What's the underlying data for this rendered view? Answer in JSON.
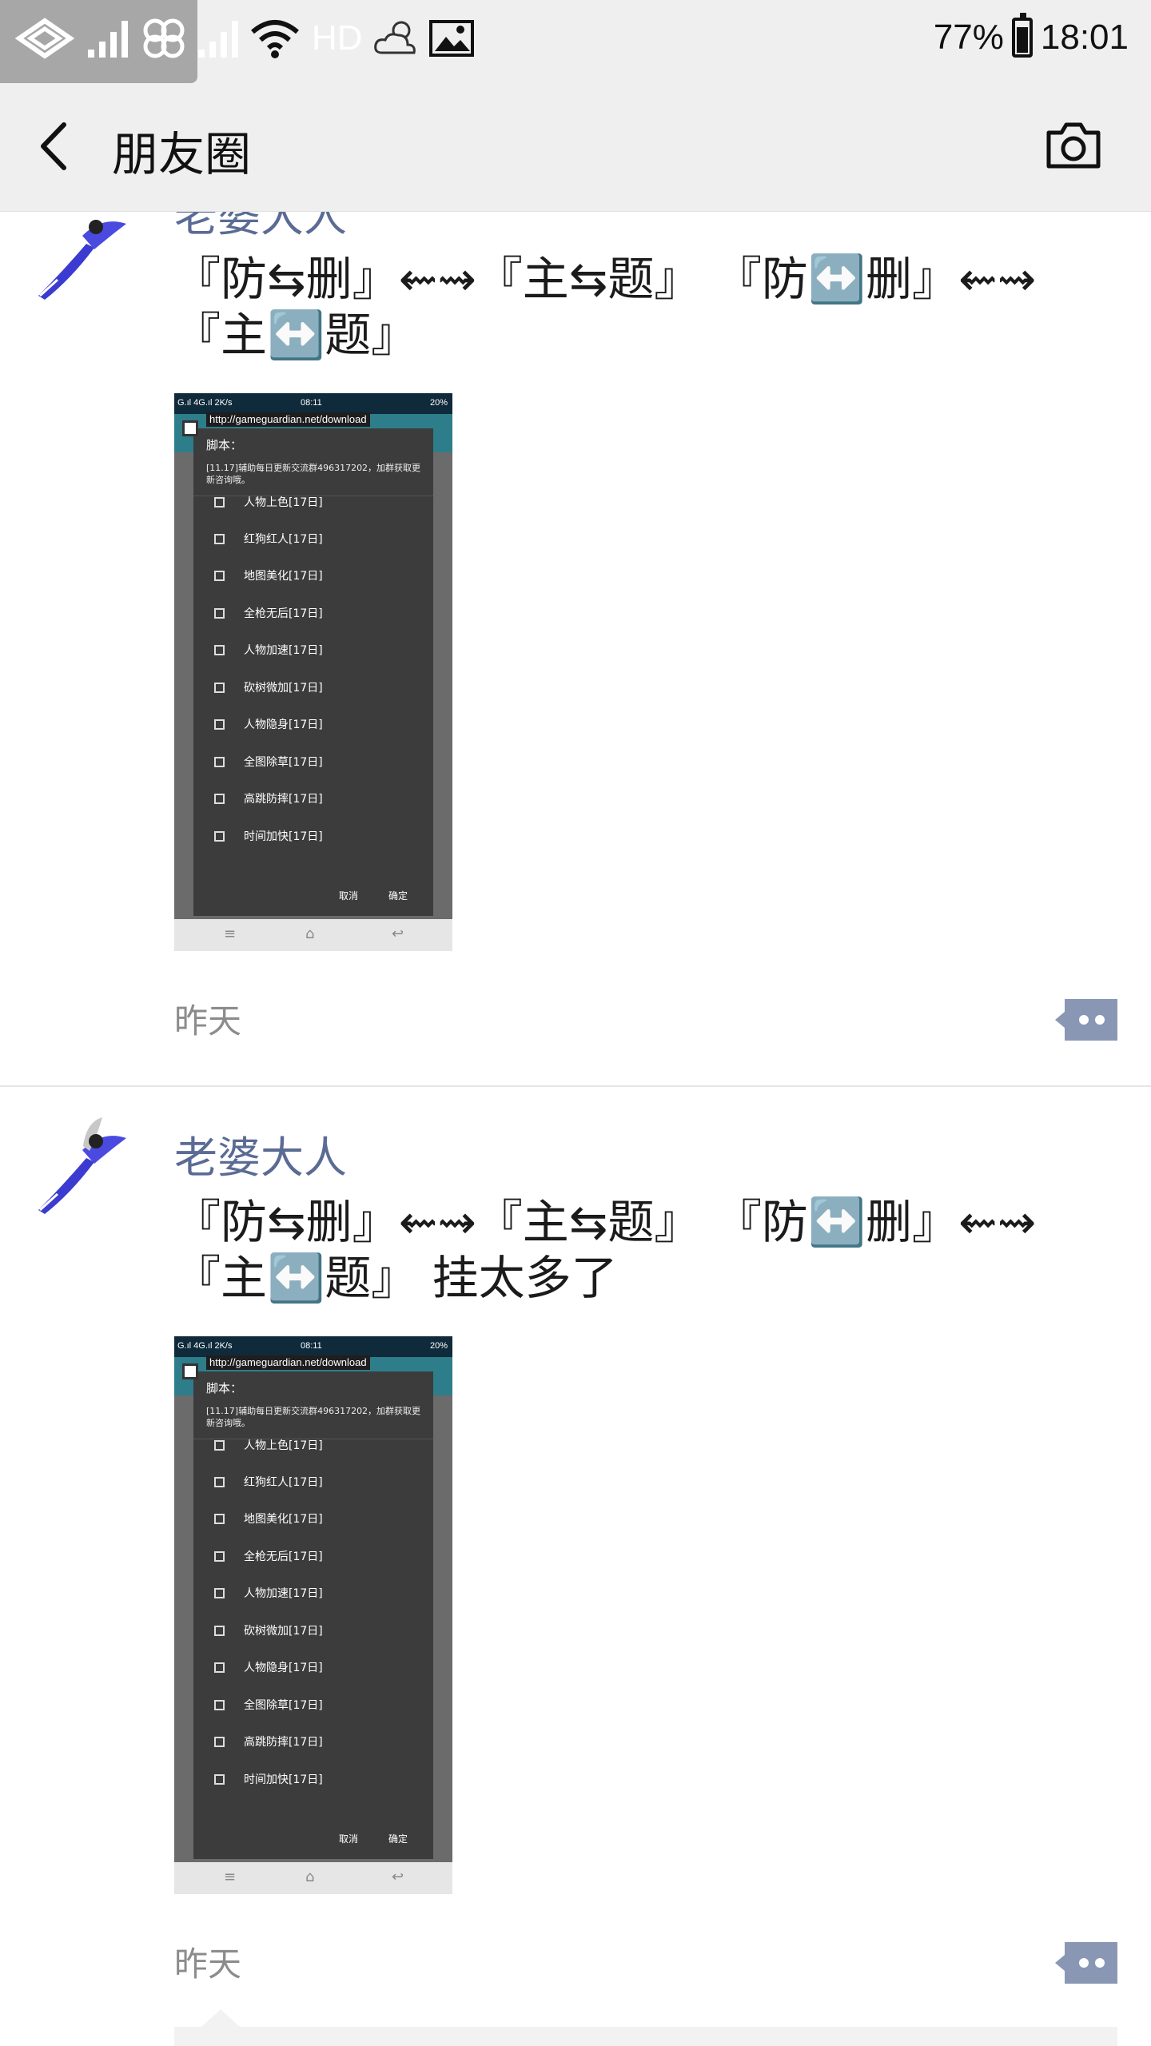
{
  "status_bar": {
    "network_label": "HD",
    "battery_percent": "77%",
    "battery_level": 0.77,
    "time": "18:01"
  },
  "nav": {
    "title": "朋友圈"
  },
  "posts": [
    {
      "author": "老婆大人",
      "text": "『防⇆删』⇜⇝『主⇆题』 『防↔️删』⇜⇝『主↔️题』",
      "time": "昨天",
      "image": {
        "status_left": "G.ıl 4G.ıl 2K/s",
        "status_time": "08:11",
        "status_right": "20%",
        "url": "http://gameguardian.net/download",
        "title": "脚本：",
        "note": "[11.17]辅助每日更新交流群496317202，加群获取更新咨询哦。",
        "items": [
          "人物上色[17日]",
          "红狗红人[17日]",
          "地图美化[17日]",
          "全枪无后[17日]",
          "人物加速[17日]",
          "砍树微加[17日]",
          "人物隐身[17日]",
          "全图除草[17日]",
          "高跳防摔[17日]",
          "时间加快[17日]"
        ],
        "cancel": "取消",
        "ok": "确定"
      }
    },
    {
      "author": "老婆大人",
      "text": "『防⇆删』⇜⇝『主⇆题』 『防↔️删』⇜⇝『主↔️题』 挂太多了",
      "time": "昨天",
      "image": {
        "status_left": "G.ıl 4G.ıl 2K/s",
        "status_time": "08:11",
        "status_right": "20%",
        "url": "http://gameguardian.net/download",
        "title": "脚本：",
        "note": "[11.17]辅助每日更新交流群496317202，加群获取更新咨询哦。",
        "items": [
          "人物上色[17日]",
          "红狗红人[17日]",
          "地图美化[17日]",
          "全枪无后[17日]",
          "人物加速[17日]",
          "砍树微加[17日]",
          "人物隐身[17日]",
          "全图除草[17日]",
          "高跳防摔[17日]",
          "时间加快[17日]"
        ],
        "cancel": "取消",
        "ok": "确定"
      }
    }
  ],
  "icons": {
    "back": "back-arrow-icon",
    "camera": "camera-icon",
    "more": "comment-more-icon"
  }
}
